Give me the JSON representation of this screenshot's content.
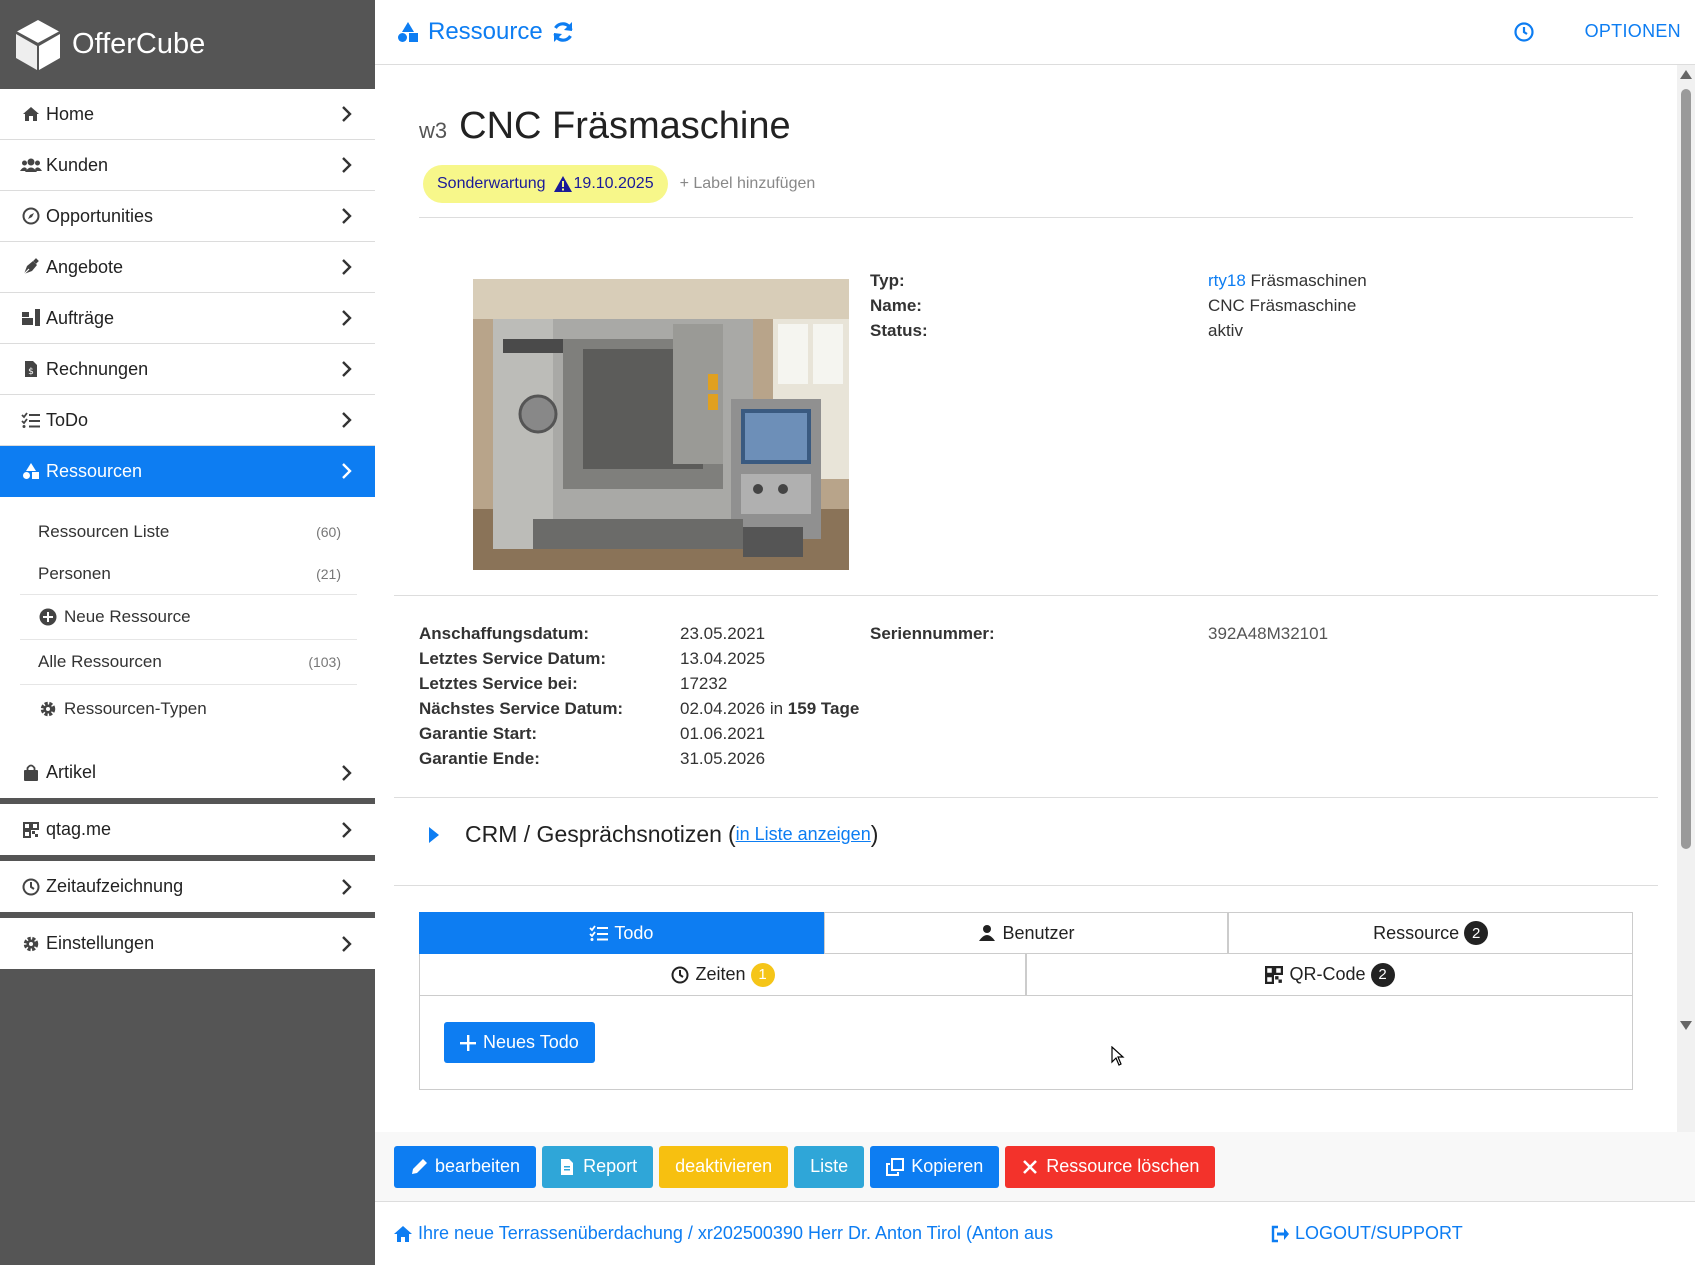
{
  "brand": {
    "name": "OfferCube"
  },
  "sidebar": {
    "items": [
      {
        "label": "Home",
        "icon": "home-icon"
      },
      {
        "label": "Kunden",
        "icon": "users-icon"
      },
      {
        "label": "Opportunities",
        "icon": "compass-icon"
      },
      {
        "label": "Angebote",
        "icon": "pen-nib-icon"
      },
      {
        "label": "Aufträge",
        "icon": "truck-loading-icon"
      },
      {
        "label": "Rechnungen",
        "icon": "invoice-icon"
      },
      {
        "label": "ToDo",
        "icon": "tasks-icon"
      },
      {
        "label": "Ressourcen",
        "icon": "shapes-icon"
      }
    ],
    "submenu": [
      {
        "label": "Ressourcen Liste",
        "count": "(60)"
      },
      {
        "label": "Personen",
        "count": "(21)"
      },
      {
        "label": "Neue Ressource",
        "count": ""
      },
      {
        "label": "Alle Ressourcen",
        "count": "(103)"
      },
      {
        "label": "Ressourcen-Typen",
        "count": ""
      }
    ],
    "bottom_items": [
      {
        "label": "Artikel",
        "icon": "shopping-bag-icon"
      },
      {
        "label": "qtag.me",
        "icon": "qr-code-icon"
      },
      {
        "label": "Zeitaufzeichnung",
        "icon": "clock-icon"
      },
      {
        "label": "Einstellungen",
        "icon": "gear-icon"
      }
    ]
  },
  "topbar": {
    "title": "Ressource",
    "options": "OPTIONEN"
  },
  "resource": {
    "code": "w3",
    "name": "CNC Fräsmaschine",
    "label_text": "Sonderwartung",
    "label_date": "19.10.2025",
    "add_label": "+ Label hinzufügen",
    "info": {
      "typ_key": "Typ:",
      "typ_link": "rty18",
      "typ_value": "Fräsmaschinen",
      "name_key": "Name:",
      "name_value": "CNC Fräsmaschine",
      "status_key": "Status:",
      "status_value": "aktiv"
    },
    "details": [
      {
        "key": "Anschaffungsdatum:",
        "value": "23.05.2021"
      },
      {
        "key": "Letztes Service Datum:",
        "value": "13.04.2025"
      },
      {
        "key": "Letztes Service bei:",
        "value": "17232"
      },
      {
        "key": "Nächstes Service Datum:",
        "value": "02.04.2026",
        "in": "in",
        "days": "159 Tage"
      },
      {
        "key": "Garantie Start:",
        "value": "01.06.2021"
      },
      {
        "key": "Garantie Ende:",
        "value": "31.05.2026"
      }
    ],
    "serial_key": "Seriennummer:",
    "serial_value": "392A48M32101"
  },
  "crm": {
    "title": "CRM / Gesprächsnotizen",
    "paren_open": "(",
    "link": "in Liste anzeigen",
    "paren_close": ")"
  },
  "tabs": {
    "row1": [
      {
        "label": "Todo",
        "badge": ""
      },
      {
        "label": "Benutzer",
        "badge": ""
      },
      {
        "label": "Ressource",
        "badge": "2"
      }
    ],
    "row2": [
      {
        "label": "Zeiten",
        "badge": "1"
      },
      {
        "label": "QR-Code",
        "badge": "2"
      }
    ],
    "new_todo": "Neues Todo"
  },
  "actions": {
    "edit": "bearbeiten",
    "report": "Report",
    "deactivate": "deaktivieren",
    "list": "Liste",
    "copy": "Kopieren",
    "delete": "Ressource löschen"
  },
  "footer": {
    "breadcrumb": "Ihre neue Terrassenüberdachung / xr202500390 Herr Dr. Anton Tirol (Anton aus",
    "logout": "LOGOUT/SUPPORT"
  },
  "colors": {
    "primary": "#0d7df2",
    "sidebar_bg": "#555555",
    "label_bg": "#f7f78a",
    "cyan": "#2fa6d8",
    "yellow": "#f7c010",
    "red": "#f3322b"
  }
}
